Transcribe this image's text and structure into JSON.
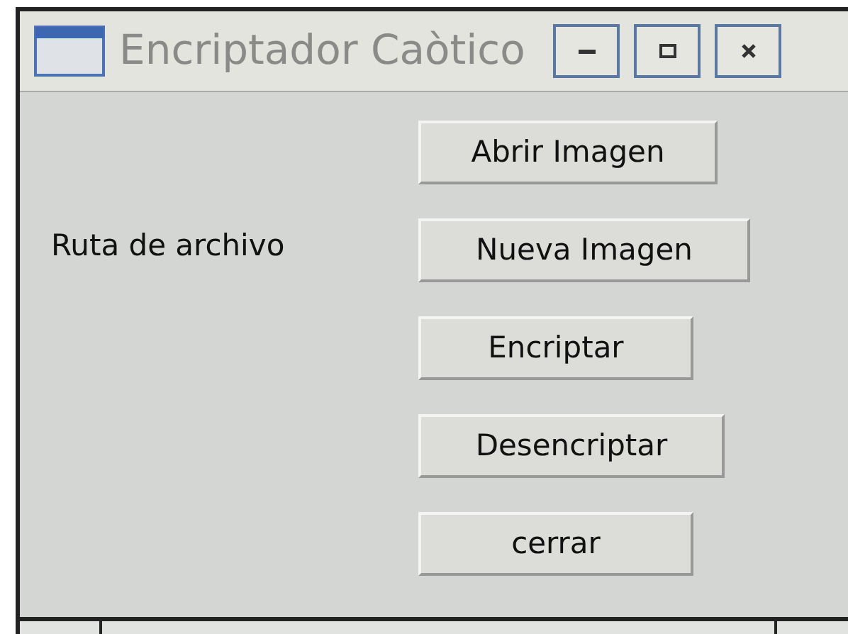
{
  "window": {
    "title": "Encriptador Caòtico",
    "controls": [
      {
        "kind": "minimize"
      },
      {
        "kind": "maximize"
      },
      {
        "kind": "close"
      }
    ]
  },
  "label": "Ruta de archivo",
  "buttons": [
    {
      "label": "Abrir Imagen"
    },
    {
      "label": "Nueva Imagen"
    },
    {
      "label": "Encriptar"
    },
    {
      "label": "Desencriptar"
    },
    {
      "label": "cerrar"
    }
  ]
}
